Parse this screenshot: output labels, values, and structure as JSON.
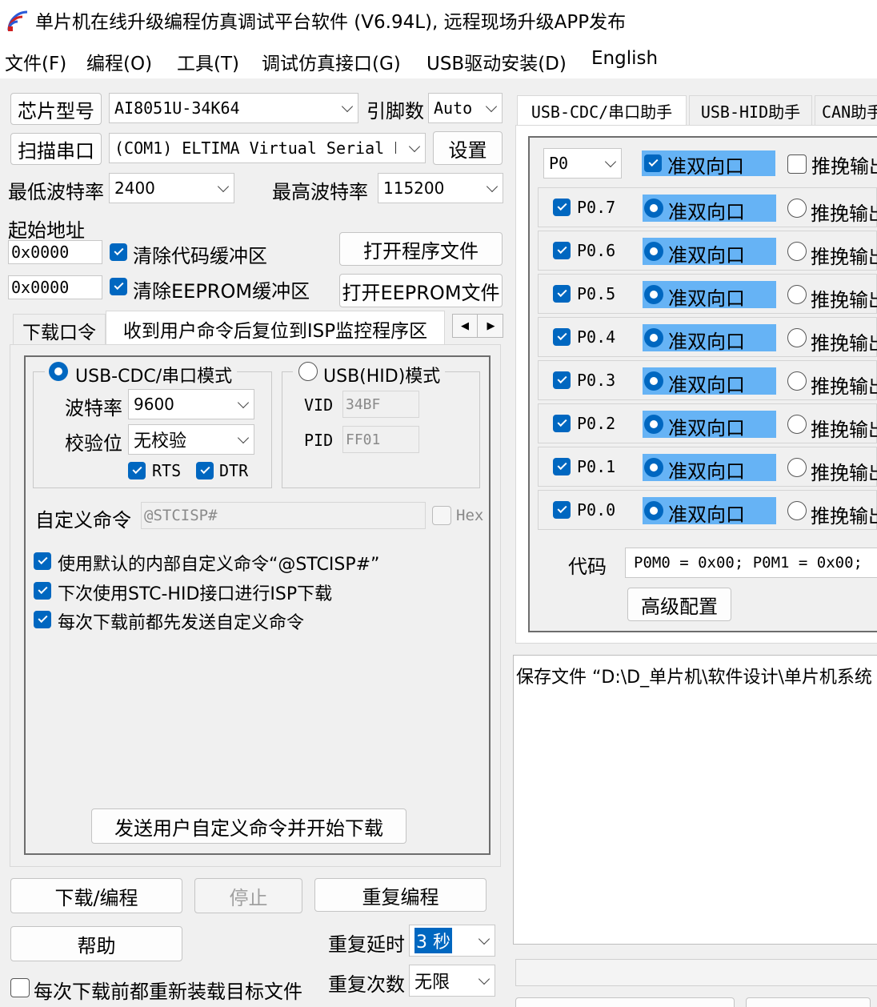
{
  "app": {
    "title": "单片机在线升级编程仿真调试平台软件 (V6.94L), 远程现场升级APP发布"
  },
  "menu": [
    "文件(F)",
    "编程(O)",
    "工具(T)",
    "调试仿真接口(G)",
    "USB驱动安装(D)",
    "English"
  ],
  "chip": {
    "label": "芯片型号",
    "value": "AI8051U-34K64",
    "pins_label": "引脚数",
    "pins_value": "Auto"
  },
  "port": {
    "scan_label": "扫描串口",
    "value": "(COM1) ELTIMA Virtual Serial P",
    "settings_label": "设置"
  },
  "baud": {
    "min_label": "最低波特率",
    "min_value": "2400",
    "max_label": "最高波特率",
    "max_value": "115200"
  },
  "start_addr": {
    "label": "起始地址",
    "code_addr": "0x0000",
    "clear_code": "清除代码缓冲区",
    "open_program": "打开程序文件",
    "eeprom_addr": "0x0000",
    "clear_eeprom": "清除EEPROM缓冲区",
    "open_eeprom": "打开EEPROM文件"
  },
  "left_tabs": [
    "下载口令",
    "收到用户命令后复位到ISP监控程序区"
  ],
  "cmd_panel": {
    "cdc_mode": "USB-CDC/串口模式",
    "baud_label": "波特率",
    "baud_value": "9600",
    "parity_label": "校验位",
    "parity_value": "无校验",
    "rts": "RTS",
    "dtr": "DTR",
    "hid_mode": "USB(HID)模式",
    "vid_label": "VID",
    "vid_value": "34BF",
    "pid_label": "PID",
    "pid_value": "FF01",
    "custom_label": "自定义命令",
    "custom_value": "@STCISP#",
    "hex_label": "Hex",
    "opt1": "使用默认的内部自定义命令“@STCISP#”",
    "opt2": "下次使用STC-HID接口进行ISP下载",
    "opt3": "每次下载前都先发送自定义命令",
    "send_button": "发送用户自定义命令并开始下载"
  },
  "bottom": {
    "download": "下载/编程",
    "stop": "停止",
    "repeat": "重复编程",
    "help": "帮助",
    "delay_label": "重复延时",
    "delay_value": "3 秒",
    "count_label": "重复次数",
    "count_value": "无限",
    "reload": "每次下载前都重新装载目标文件"
  },
  "right_tabs": [
    "USB-CDC/串口助手",
    "USB-HID助手",
    "CAN助手"
  ],
  "io": {
    "port_value": "P0",
    "mode_label": "准双向口",
    "alt_label": "推挽输出",
    "pins": [
      "P0.7",
      "P0.6",
      "P0.5",
      "P0.4",
      "P0.3",
      "P0.2",
      "P0.1",
      "P0.0"
    ],
    "code_label": "代码",
    "code_value": "P0M0 = 0x00; P0M1 = 0x00;",
    "advanced": "高级配置"
  },
  "log": {
    "line": "保存文件 “D:\\D_单片机\\软件设计\\单片机系统"
  },
  "colors": {
    "accent": "#0067c0",
    "highlight": "#66b3f5"
  }
}
